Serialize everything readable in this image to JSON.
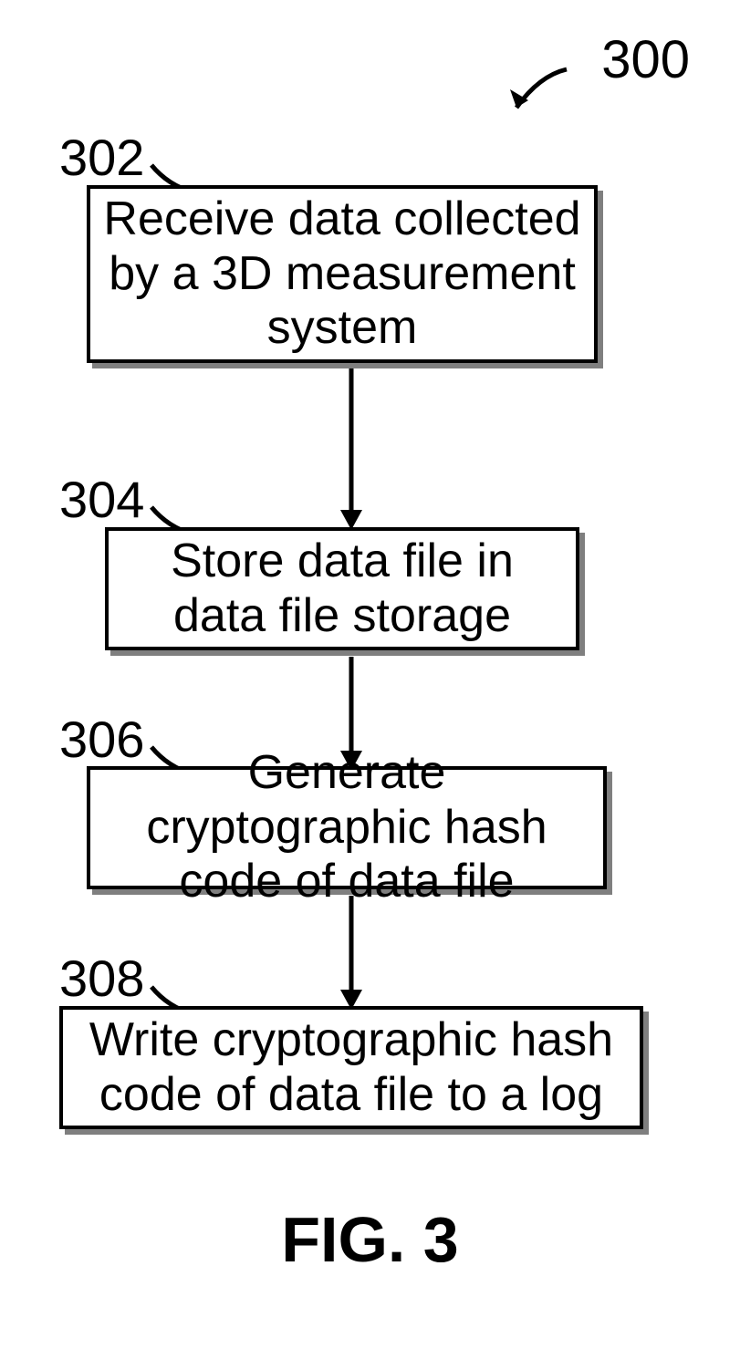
{
  "diagram": {
    "main_reference": "300",
    "figure_label": "FIG. 3",
    "steps": [
      {
        "ref": "302",
        "text": "Receive data collected by a 3D measurement system"
      },
      {
        "ref": "304",
        "text": "Store data file in data file storage"
      },
      {
        "ref": "306",
        "text": "Generate cryptographic hash code of data file"
      },
      {
        "ref": "308",
        "text": "Write cryptographic hash code of data file to a log"
      }
    ]
  }
}
